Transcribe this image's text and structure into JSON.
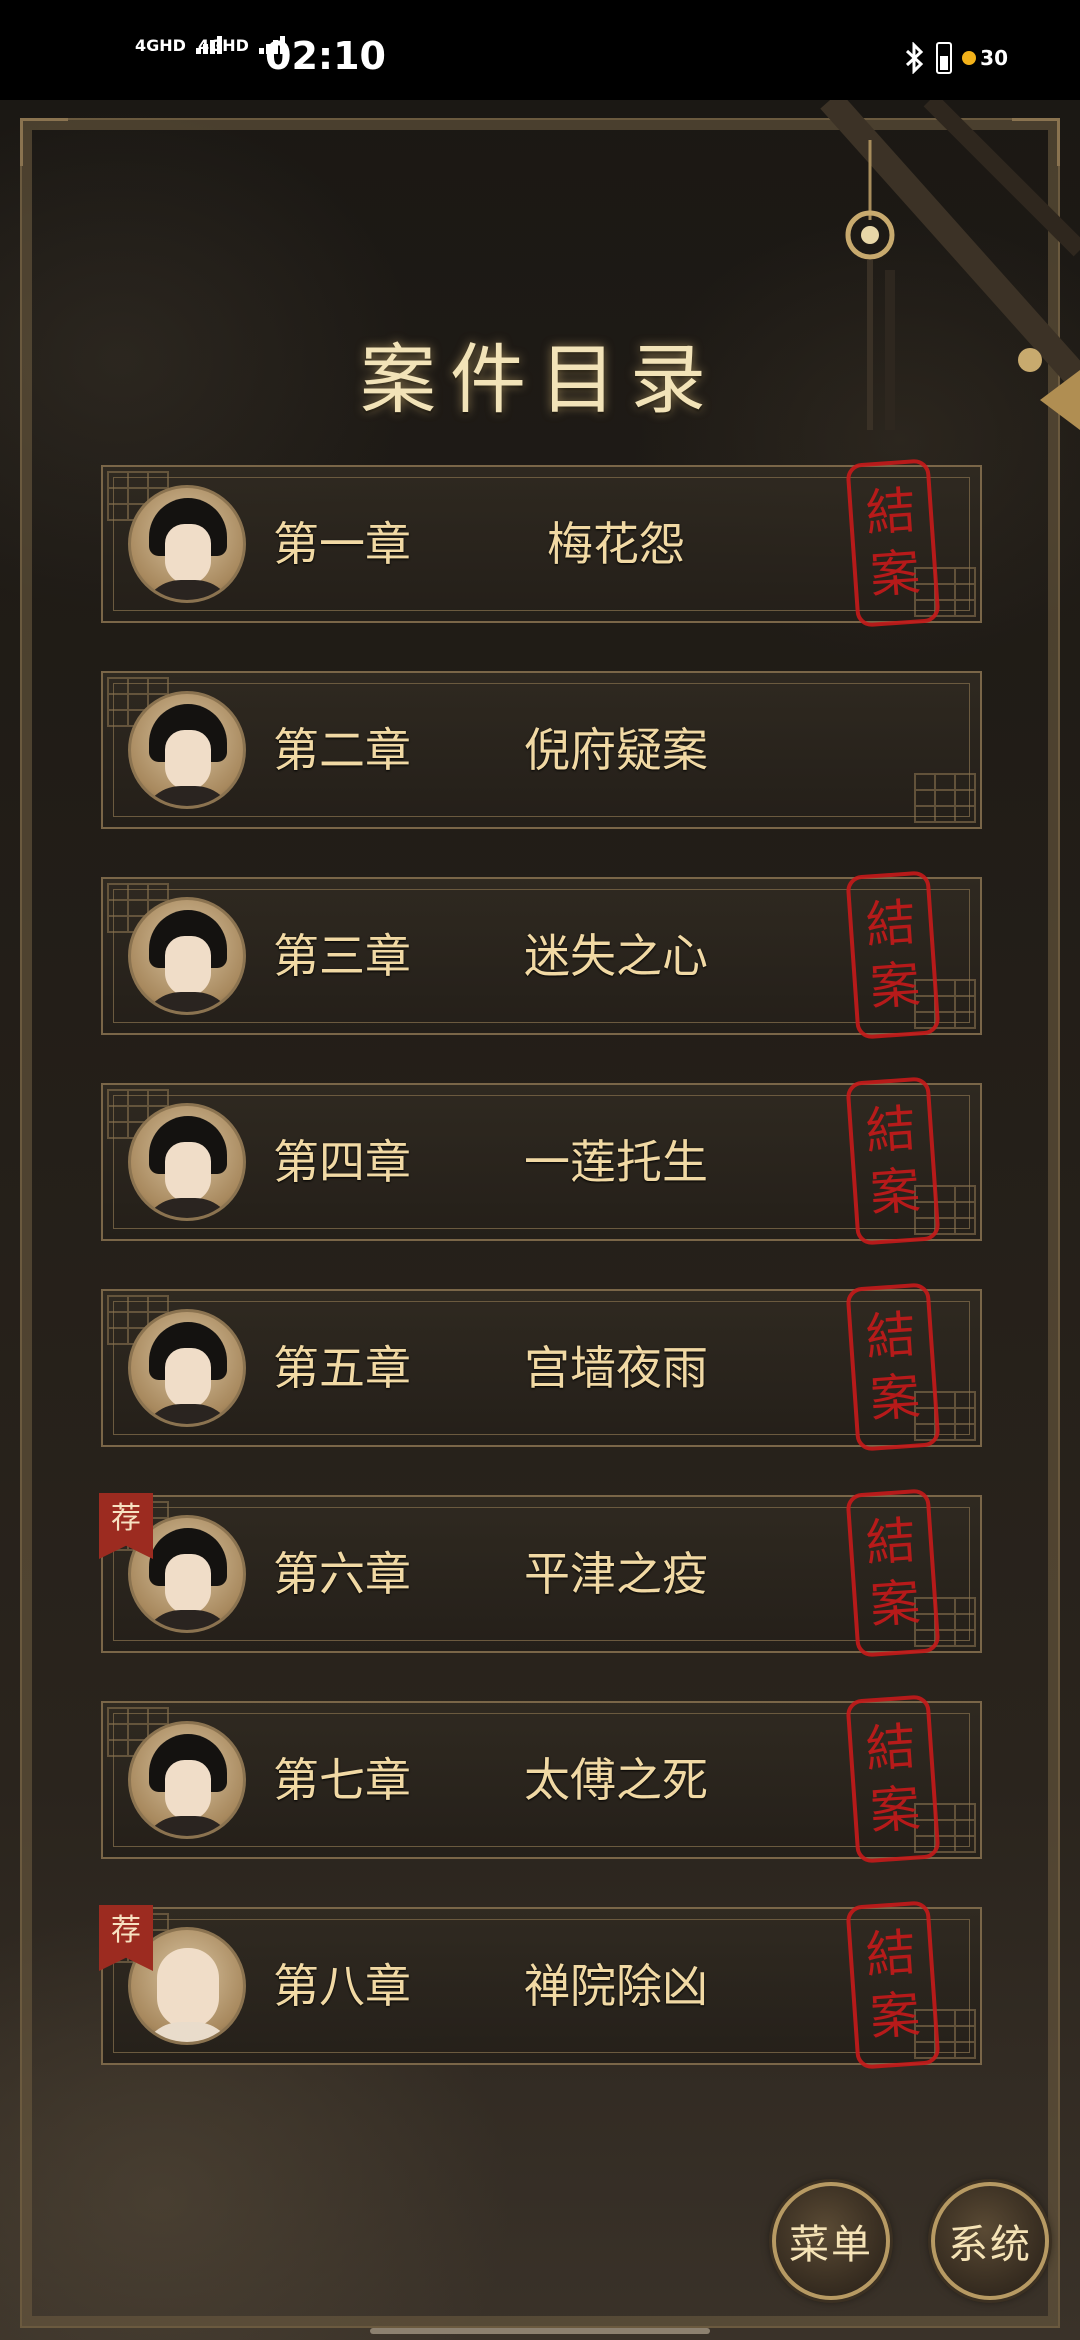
{
  "status_bar": {
    "signal_1": "4GHD",
    "signal_2": "4GHD",
    "time": "02:10",
    "coins": "30"
  },
  "title": "案件目录",
  "stamp_text": [
    "結",
    "案"
  ],
  "recommend_tag": "荐",
  "chapters": [
    {
      "num": "第一章",
      "name": "梅花怨",
      "closed": true,
      "recommended": false
    },
    {
      "num": "第二章",
      "name": "倪府疑案",
      "closed": false,
      "recommended": false
    },
    {
      "num": "第三章",
      "name": "迷失之心",
      "closed": true,
      "recommended": false
    },
    {
      "num": "第四章",
      "name": "一莲托生",
      "closed": true,
      "recommended": false
    },
    {
      "num": "第五章",
      "name": "宫墙夜雨",
      "closed": true,
      "recommended": false
    },
    {
      "num": "第六章",
      "name": "平津之疫",
      "closed": true,
      "recommended": true
    },
    {
      "num": "第七章",
      "name": "太傅之死",
      "closed": true,
      "recommended": false
    },
    {
      "num": "第八章",
      "name": "禅院除凶",
      "closed": true,
      "recommended": true
    }
  ],
  "buttons": {
    "menu": "菜单",
    "system": "系统"
  }
}
